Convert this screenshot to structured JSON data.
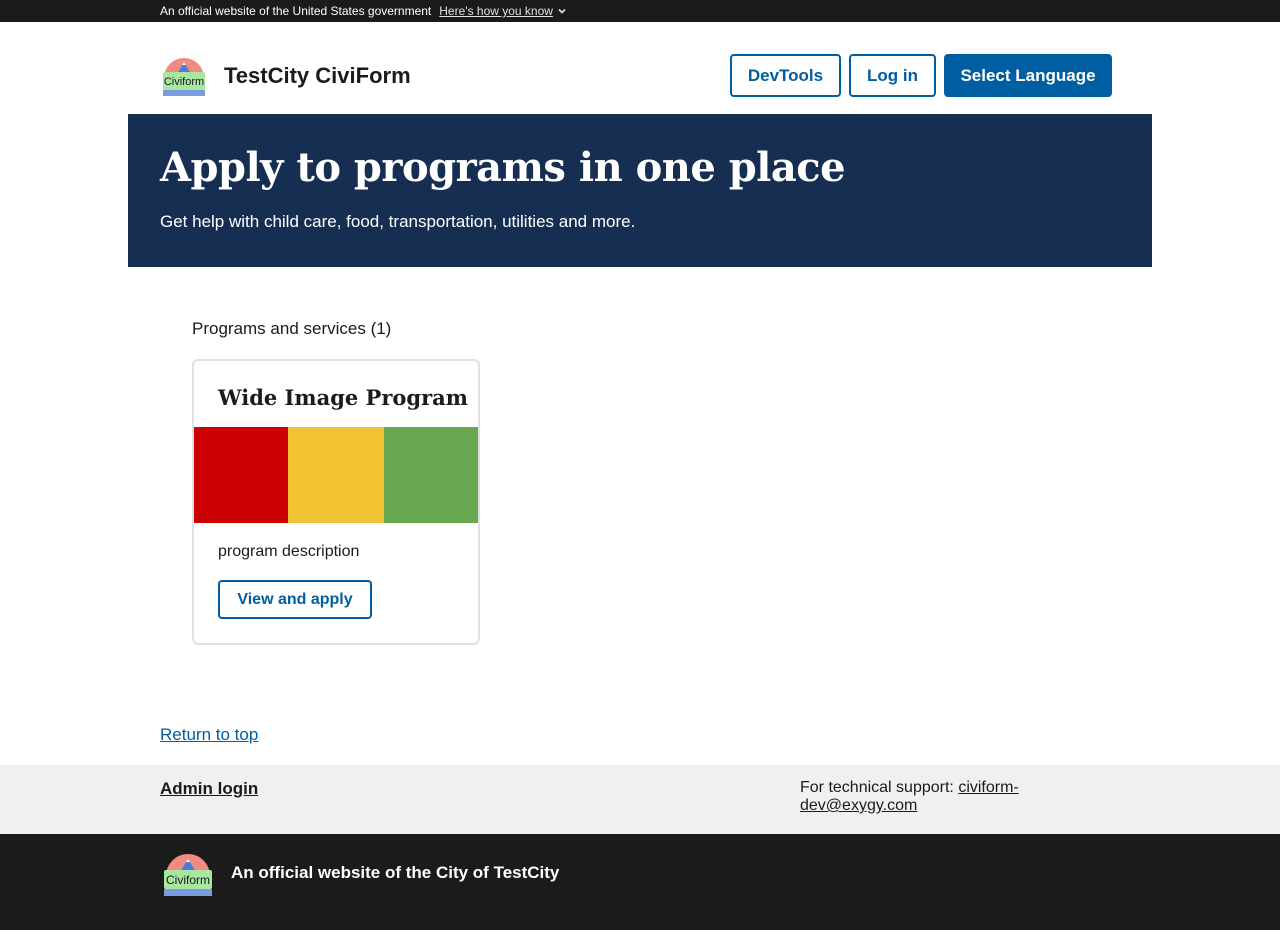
{
  "gov_banner": {
    "text": "An official website of the United States government",
    "link_label": "Here's how you know"
  },
  "header": {
    "site_title": "TestCity CiviForm",
    "logo_text": "Civiform",
    "devtools_label": "DevTools",
    "login_label": "Log in",
    "language_label": "Select Language"
  },
  "hero": {
    "title": "Apply to programs in one place",
    "subtitle": "Get help with child care, food, transportation, utilities and more."
  },
  "programs": {
    "heading": "Programs and services (1)",
    "cards": [
      {
        "title": "Wide Image Program",
        "image_colors": [
          "#cc0000",
          "#f1c232",
          "#6aa84f"
        ],
        "description": "program description",
        "button_label": "View and apply"
      }
    ]
  },
  "return_to_top": "Return to top",
  "footer": {
    "admin_login": "Admin login",
    "support_label": "For technical support:",
    "support_email": "civiform-dev@exygy.com",
    "official_text": "An official website of the City of TestCity",
    "logo_text": "Civiform"
  },
  "colors": {
    "primary": "#005ea2",
    "hero_bg": "#162e51",
    "banner_bg": "#1b1b1b",
    "footer_gray": "#f0f0f0"
  }
}
